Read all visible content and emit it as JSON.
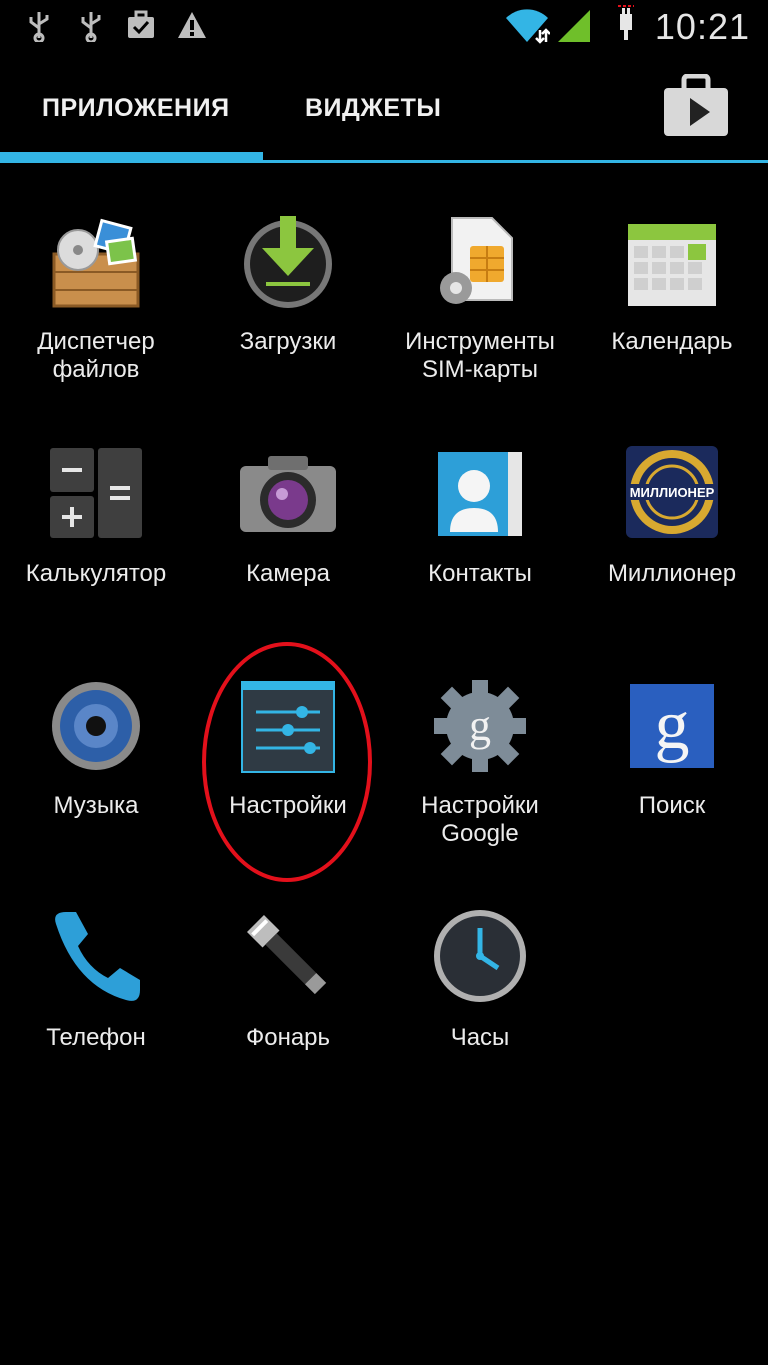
{
  "status_bar": {
    "time": "10:21",
    "icons": [
      "usb-icon",
      "usb-icon",
      "briefcase-check-icon",
      "warning-icon",
      "wifi-icon",
      "signal-icon",
      "charging-icon"
    ]
  },
  "tabs": {
    "apps": "ПРИЛОЖЕНИЯ",
    "widgets": "ВИДЖЕТЫ",
    "active": "apps",
    "accent_color": "#33b5e5"
  },
  "apps": [
    {
      "label": "Диспетчер файлов",
      "icon": "file-manager-icon"
    },
    {
      "label": "Загрузки",
      "icon": "downloads-icon"
    },
    {
      "label": "Инструменты SIM-карты",
      "icon": "sim-toolkit-icon"
    },
    {
      "label": "Календарь",
      "icon": "calendar-icon"
    },
    {
      "label": "Калькулятор",
      "icon": "calculator-icon"
    },
    {
      "label": "Камера",
      "icon": "camera-icon"
    },
    {
      "label": "Контакты",
      "icon": "contacts-icon"
    },
    {
      "label": "Миллионер",
      "icon": "millionaire-icon",
      "icon_text": "МИЛЛИОНЕР"
    },
    {
      "label": "Музыка",
      "icon": "music-icon"
    },
    {
      "label": "Настройки",
      "icon": "settings-icon",
      "highlighted": true
    },
    {
      "label": "Настройки Google",
      "icon": "google-settings-icon"
    },
    {
      "label": "Поиск",
      "icon": "search-icon"
    },
    {
      "label": "Телефон",
      "icon": "phone-icon"
    },
    {
      "label": "Фонарь",
      "icon": "flashlight-icon"
    },
    {
      "label": "Часы",
      "icon": "clock-icon"
    }
  ],
  "highlight_color": "#e3101b"
}
